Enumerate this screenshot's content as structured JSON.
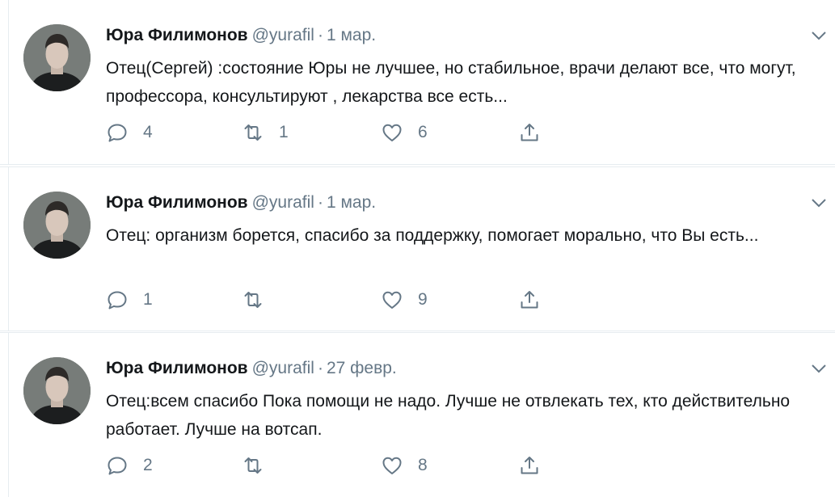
{
  "tweets": [
    {
      "name": "Юра Филимонов",
      "handle": "@yurafil",
      "separator": "·",
      "date": "1 мар.",
      "text": "Отец(Сергей) :состояние Юры не лучшее, но стабильное, врачи делают все, что могут, профессора, консультируют , лекарства все есть...",
      "replies": "4",
      "retweets": "1",
      "likes": "6"
    },
    {
      "name": "Юра Филимонов",
      "handle": "@yurafil",
      "separator": "·",
      "date": "1 мар.",
      "text": "Отец: организм борется, спасибо за поддержку, помогает морально, что Вы есть...",
      "replies": "1",
      "retweets": "",
      "likes": "9"
    },
    {
      "name": "Юра Филимонов",
      "handle": "@yurafil",
      "separator": "·",
      "date": "27 февр.",
      "text": "Отец:всем спасибо Пока помощи не надо. Лучше не отвлекать тех, кто действительно работает. Лучше на вотсап.",
      "replies": "2",
      "retweets": "",
      "likes": "8"
    }
  ],
  "icons": {
    "reply": "reply-icon",
    "retweet": "retweet-icon",
    "like": "heart-icon",
    "share": "share-icon",
    "menu": "chevron-down-icon"
  },
  "colors": {
    "text": "#14171a",
    "secondary": "#657786",
    "divider": "#e6ecf0"
  }
}
